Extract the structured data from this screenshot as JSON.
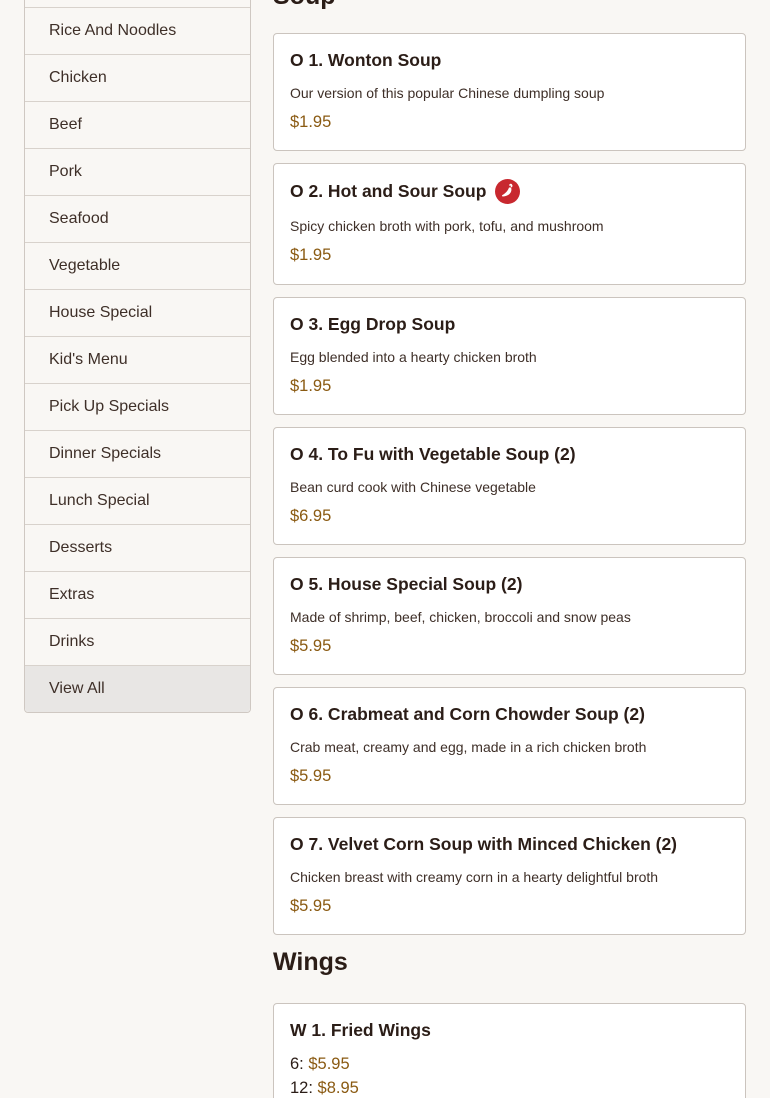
{
  "sidebar": {
    "items": [
      {
        "label": "Rice And Noodles"
      },
      {
        "label": "Chicken"
      },
      {
        "label": "Beef"
      },
      {
        "label": "Pork"
      },
      {
        "label": "Seafood"
      },
      {
        "label": "Vegetable"
      },
      {
        "label": "House Special"
      },
      {
        "label": "Kid's Menu"
      },
      {
        "label": "Pick Up Specials"
      },
      {
        "label": "Dinner Specials"
      },
      {
        "label": "Lunch Special"
      },
      {
        "label": "Desserts"
      },
      {
        "label": "Extras"
      },
      {
        "label": "Drinks"
      },
      {
        "label": "View All"
      }
    ],
    "active_item": "View All"
  },
  "sections": {
    "soup": {
      "heading": "Soup",
      "items": [
        {
          "title": "O 1. Wonton Soup",
          "description": "Our version of this popular Chinese dumpling soup",
          "price": "$1.95",
          "spicy": false
        },
        {
          "title": "O 2. Hot and Sour Soup",
          "description": "Spicy chicken broth with pork, tofu, and mushroom",
          "price": "$1.95",
          "spicy": true
        },
        {
          "title": "O 3. Egg Drop Soup",
          "description": "Egg blended into a hearty chicken broth",
          "price": "$1.95",
          "spicy": false
        },
        {
          "title": "O 4. To Fu with Vegetable Soup (2)",
          "description": "Bean curd cook with Chinese vegetable",
          "price": "$6.95",
          "spicy": false
        },
        {
          "title": "O 5. House Special Soup (2)",
          "description": "Made of shrimp, beef, chicken, broccoli and snow peas",
          "price": "$5.95",
          "spicy": false
        },
        {
          "title": "O 6. Crabmeat and Corn Chowder Soup (2)",
          "description": "Crab meat, creamy and egg, made in a rich chicken broth",
          "price": "$5.95",
          "spicy": false
        },
        {
          "title": "O 7. Velvet Corn Soup with Minced Chicken (2)",
          "description": "Chicken breast with creamy corn in a hearty delightful broth",
          "price": "$5.95",
          "spicy": false
        }
      ]
    },
    "wings": {
      "heading": "Wings",
      "items": [
        {
          "title": "W 1. Fried Wings",
          "options": [
            {
              "label": "6:",
              "price": "$5.95"
            },
            {
              "label": "12:",
              "price": "$8.95"
            }
          ]
        }
      ]
    }
  },
  "icons": {
    "spicy": "chili-pepper-icon"
  },
  "colors": {
    "price": "#8a5a12",
    "spicy_badge": "#c8282f",
    "active_sidebar_bg": "#e8e6e4"
  }
}
